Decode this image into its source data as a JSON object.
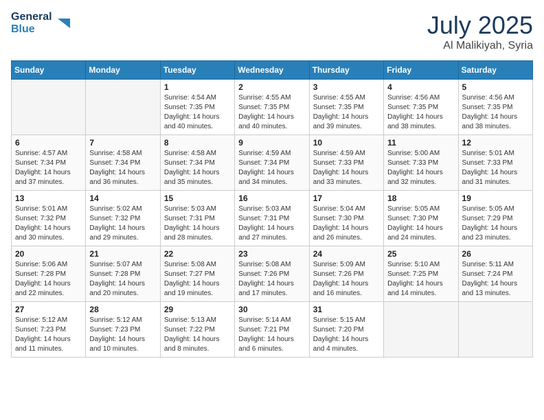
{
  "logo": {
    "text_general": "General",
    "text_blue": "Blue"
  },
  "header": {
    "month_year": "July 2025",
    "location": "Al Malikiyah, Syria"
  },
  "weekdays": [
    "Sunday",
    "Monday",
    "Tuesday",
    "Wednesday",
    "Thursday",
    "Friday",
    "Saturday"
  ],
  "weeks": [
    [
      {
        "day": "",
        "empty": true
      },
      {
        "day": "",
        "empty": true
      },
      {
        "day": "1",
        "sunrise": "4:54 AM",
        "sunset": "7:35 PM",
        "daylight": "14 hours and 40 minutes."
      },
      {
        "day": "2",
        "sunrise": "4:55 AM",
        "sunset": "7:35 PM",
        "daylight": "14 hours and 40 minutes."
      },
      {
        "day": "3",
        "sunrise": "4:55 AM",
        "sunset": "7:35 PM",
        "daylight": "14 hours and 39 minutes."
      },
      {
        "day": "4",
        "sunrise": "4:56 AM",
        "sunset": "7:35 PM",
        "daylight": "14 hours and 38 minutes."
      },
      {
        "day": "5",
        "sunrise": "4:56 AM",
        "sunset": "7:35 PM",
        "daylight": "14 hours and 38 minutes."
      }
    ],
    [
      {
        "day": "6",
        "sunrise": "4:57 AM",
        "sunset": "7:34 PM",
        "daylight": "14 hours and 37 minutes."
      },
      {
        "day": "7",
        "sunrise": "4:58 AM",
        "sunset": "7:34 PM",
        "daylight": "14 hours and 36 minutes."
      },
      {
        "day": "8",
        "sunrise": "4:58 AM",
        "sunset": "7:34 PM",
        "daylight": "14 hours and 35 minutes."
      },
      {
        "day": "9",
        "sunrise": "4:59 AM",
        "sunset": "7:34 PM",
        "daylight": "14 hours and 34 minutes."
      },
      {
        "day": "10",
        "sunrise": "4:59 AM",
        "sunset": "7:33 PM",
        "daylight": "14 hours and 33 minutes."
      },
      {
        "day": "11",
        "sunrise": "5:00 AM",
        "sunset": "7:33 PM",
        "daylight": "14 hours and 32 minutes."
      },
      {
        "day": "12",
        "sunrise": "5:01 AM",
        "sunset": "7:33 PM",
        "daylight": "14 hours and 31 minutes."
      }
    ],
    [
      {
        "day": "13",
        "sunrise": "5:01 AM",
        "sunset": "7:32 PM",
        "daylight": "14 hours and 30 minutes."
      },
      {
        "day": "14",
        "sunrise": "5:02 AM",
        "sunset": "7:32 PM",
        "daylight": "14 hours and 29 minutes."
      },
      {
        "day": "15",
        "sunrise": "5:03 AM",
        "sunset": "7:31 PM",
        "daylight": "14 hours and 28 minutes."
      },
      {
        "day": "16",
        "sunrise": "5:03 AM",
        "sunset": "7:31 PM",
        "daylight": "14 hours and 27 minutes."
      },
      {
        "day": "17",
        "sunrise": "5:04 AM",
        "sunset": "7:30 PM",
        "daylight": "14 hours and 26 minutes."
      },
      {
        "day": "18",
        "sunrise": "5:05 AM",
        "sunset": "7:30 PM",
        "daylight": "14 hours and 24 minutes."
      },
      {
        "day": "19",
        "sunrise": "5:05 AM",
        "sunset": "7:29 PM",
        "daylight": "14 hours and 23 minutes."
      }
    ],
    [
      {
        "day": "20",
        "sunrise": "5:06 AM",
        "sunset": "7:28 PM",
        "daylight": "14 hours and 22 minutes."
      },
      {
        "day": "21",
        "sunrise": "5:07 AM",
        "sunset": "7:28 PM",
        "daylight": "14 hours and 20 minutes."
      },
      {
        "day": "22",
        "sunrise": "5:08 AM",
        "sunset": "7:27 PM",
        "daylight": "14 hours and 19 minutes."
      },
      {
        "day": "23",
        "sunrise": "5:08 AM",
        "sunset": "7:26 PM",
        "daylight": "14 hours and 17 minutes."
      },
      {
        "day": "24",
        "sunrise": "5:09 AM",
        "sunset": "7:26 PM",
        "daylight": "14 hours and 16 minutes."
      },
      {
        "day": "25",
        "sunrise": "5:10 AM",
        "sunset": "7:25 PM",
        "daylight": "14 hours and 14 minutes."
      },
      {
        "day": "26",
        "sunrise": "5:11 AM",
        "sunset": "7:24 PM",
        "daylight": "14 hours and 13 minutes."
      }
    ],
    [
      {
        "day": "27",
        "sunrise": "5:12 AM",
        "sunset": "7:23 PM",
        "daylight": "14 hours and 11 minutes."
      },
      {
        "day": "28",
        "sunrise": "5:12 AM",
        "sunset": "7:23 PM",
        "daylight": "14 hours and 10 minutes."
      },
      {
        "day": "29",
        "sunrise": "5:13 AM",
        "sunset": "7:22 PM",
        "daylight": "14 hours and 8 minutes."
      },
      {
        "day": "30",
        "sunrise": "5:14 AM",
        "sunset": "7:21 PM",
        "daylight": "14 hours and 6 minutes."
      },
      {
        "day": "31",
        "sunrise": "5:15 AM",
        "sunset": "7:20 PM",
        "daylight": "14 hours and 4 minutes."
      },
      {
        "day": "",
        "empty": true
      },
      {
        "day": "",
        "empty": true
      }
    ]
  ],
  "labels": {
    "sunrise": "Sunrise:",
    "sunset": "Sunset:",
    "daylight": "Daylight:"
  }
}
